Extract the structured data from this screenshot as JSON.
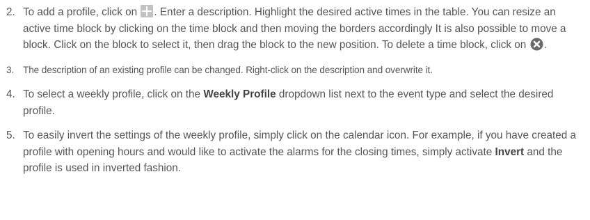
{
  "steps": [
    {
      "number": "2.",
      "part1": "To add a profile, click on ",
      "part2": ". Enter a description. Highlight the desired active times in the table. You can resize an active time block by clicking on the time block and then moving the borders accordingly It is also possible to move a block. Click on the block to select it, then drag the block to the new position. To delete a time block, click on ",
      "part3": ".",
      "icons": [
        "plus-icon",
        "close-circle-icon"
      ]
    },
    {
      "number": "3.",
      "text": "The description of an existing profile can be changed. Right-click on the description and overwrite it."
    },
    {
      "number": "4.",
      "part1": "To select a weekly profile, click on the ",
      "bold": "Weekly Profile",
      "part2": " dropdown list next to the event type and select the desired profile."
    },
    {
      "number": "5.",
      "part1": "To easily invert the settings of the weekly profile, simply click on the calendar icon. For example, if you have created a profile with opening hours and would like to activate the alarms for the closing times, simply activate ",
      "bold": "Invert",
      "part2": " and the profile is used in inverted fashion."
    }
  ],
  "colors": {
    "text": "#555555",
    "icon": "#c2c2c2"
  }
}
